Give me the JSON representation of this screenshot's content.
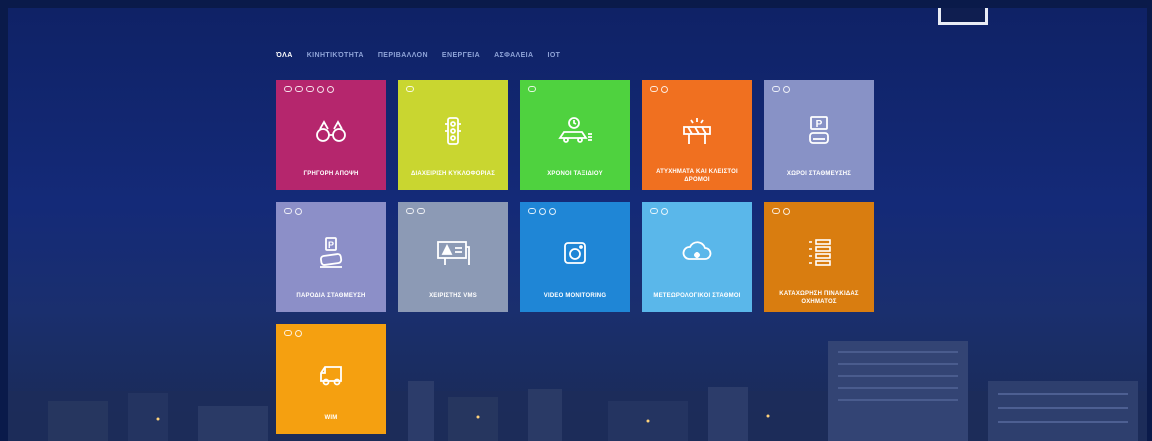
{
  "nav": {
    "tabs": [
      {
        "label": "ΌΛΑ",
        "active": true
      },
      {
        "label": "ΚΙΝΗΤΙΚΌΤΗΤΑ",
        "active": false
      },
      {
        "label": "ΠΕΡΙΒΑΛΛΟΝ",
        "active": false
      },
      {
        "label": "ΕΝΕΡΓΕΙΑ",
        "active": false
      },
      {
        "label": "ΑΣΦΑΛΕΙΑ",
        "active": false
      },
      {
        "label": "IOT",
        "active": false
      }
    ]
  },
  "tiles": [
    {
      "label": "ΓΡΗΓΟΡΗ ΑΠΟΨΗ",
      "color": "#b5266d",
      "icon": "binoculars-icon"
    },
    {
      "label": "ΔΙΑΧΕΙΡΙΣΗ ΚΥΚΛΟΦΟΡΙΑΣ",
      "color": "#c9d630",
      "icon": "traffic-light-icon"
    },
    {
      "label": "ΧΡΟΝΟΙ ΤΑΞΙΔΙΟΥ",
      "color": "#4fd23f",
      "icon": "car-timer-icon"
    },
    {
      "label": "ΑΤΥΧΗΜΑΤΑ ΚΑΙ ΚΛΕΙΣΤΟΙ ΔΡΟΜΟΙ",
      "color": "#f07020",
      "icon": "roadblock-icon"
    },
    {
      "label": "ΧΩΡΟΙ ΣΤΑΘΜΕΥΣΗΣ",
      "color": "#8892c6",
      "icon": "parking-icon"
    },
    {
      "label": "ΠΑΡΟΔΙΑ ΣΤΑΘΜΕΥΣΗ",
      "color": "#8c8fc8",
      "icon": "street-parking-icon"
    },
    {
      "label": "ΧΕΙΡΙΣΤΗΣ VMS",
      "color": "#8c9ab5",
      "icon": "vms-sign-icon"
    },
    {
      "label": "VIDEO MONITORING",
      "color": "#1f86d6",
      "icon": "camera-icon"
    },
    {
      "label": "ΜΕΤΕΩΡΟΛΟΓΙΚΟΙ ΣΤΑΘΜΟΙ",
      "color": "#5ab7ea",
      "icon": "weather-cloud-icon"
    },
    {
      "label": "ΚΑΤΑΧΩΡΗΣΗ ΠΙΝΑΚΙΔΑΣ ΟΧΗΜΑΤΟΣ",
      "color": "#d97d10",
      "icon": "plate-list-icon"
    },
    {
      "label": "WIM",
      "color": "#f5a010",
      "icon": "truck-icon"
    }
  ]
}
